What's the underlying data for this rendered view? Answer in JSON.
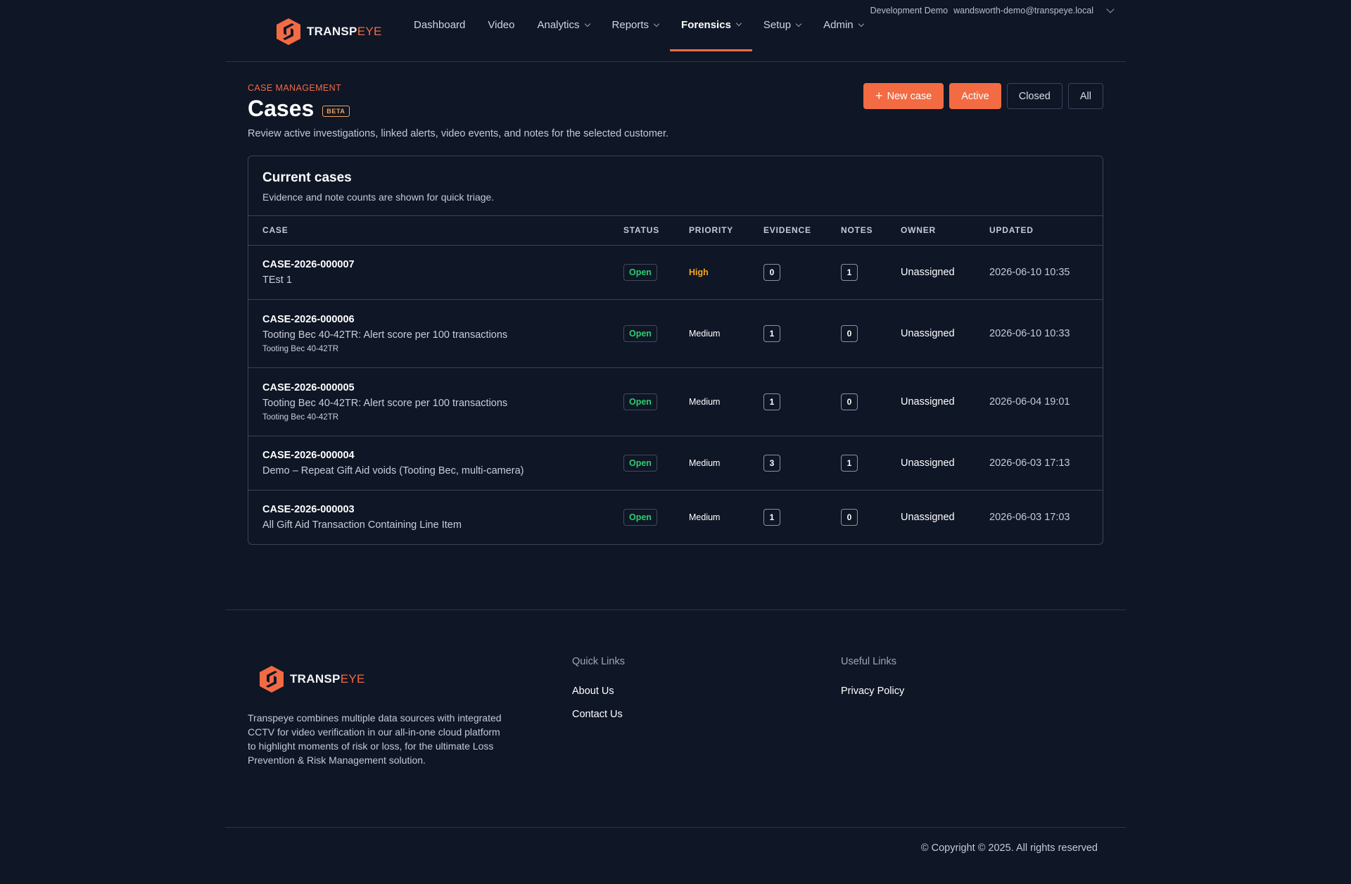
{
  "account": {
    "org": "Development Demo",
    "email": "wandsworth-demo@transpeye.local"
  },
  "brand": {
    "name_a": "TRANSP",
    "name_b": "EYE",
    "accent": "#f26b43"
  },
  "nav": [
    {
      "label": "Dashboard",
      "dropdown": false,
      "active": false
    },
    {
      "label": "Video",
      "dropdown": false,
      "active": false
    },
    {
      "label": "Analytics",
      "dropdown": true,
      "active": false
    },
    {
      "label": "Reports",
      "dropdown": true,
      "active": false
    },
    {
      "label": "Forensics",
      "dropdown": true,
      "active": true
    },
    {
      "label": "Setup",
      "dropdown": true,
      "active": false
    },
    {
      "label": "Admin",
      "dropdown": true,
      "active": false
    }
  ],
  "page": {
    "kicker": "CASE MANAGEMENT",
    "title": "Cases",
    "badge": "BETA",
    "description": "Review active investigations, linked alerts, video events, and notes for the selected customer."
  },
  "actions": {
    "new_case": "New case",
    "active": "Active",
    "closed": "Closed",
    "all": "All"
  },
  "table": {
    "title": "Current cases",
    "subtitle": "Evidence and note counts are shown for quick triage.",
    "columns": [
      "CASE",
      "STATUS",
      "PRIORITY",
      "EVIDENCE",
      "NOTES",
      "OWNER",
      "UPDATED"
    ],
    "rows": [
      {
        "id": "CASE-2026-000007",
        "title": "TEst 1",
        "store": "",
        "status": "Open",
        "priority": "High",
        "evidence": "0",
        "notes": "1",
        "owner": "Unassigned",
        "updated": "2026-06-10 10:35"
      },
      {
        "id": "CASE-2026-000006",
        "title": "Tooting Bec 40-42TR: Alert score per 100 transactions",
        "store": "Tooting Bec 40-42TR",
        "status": "Open",
        "priority": "Medium",
        "evidence": "1",
        "notes": "0",
        "owner": "Unassigned",
        "updated": "2026-06-10 10:33"
      },
      {
        "id": "CASE-2026-000005",
        "title": "Tooting Bec 40-42TR: Alert score per 100 transactions",
        "store": "Tooting Bec 40-42TR",
        "status": "Open",
        "priority": "Medium",
        "evidence": "1",
        "notes": "0",
        "owner": "Unassigned",
        "updated": "2026-06-04 19:01"
      },
      {
        "id": "CASE-2026-000004",
        "title": "Demo – Repeat Gift Aid voids (Tooting Bec, multi-camera)",
        "store": "",
        "status": "Open",
        "priority": "Medium",
        "evidence": "3",
        "notes": "1",
        "owner": "Unassigned",
        "updated": "2026-06-03 17:13"
      },
      {
        "id": "CASE-2026-000003",
        "title": "All Gift Aid Transaction Containing Line Item",
        "store": "",
        "status": "Open",
        "priority": "Medium",
        "evidence": "1",
        "notes": "0",
        "owner": "Unassigned",
        "updated": "2026-06-03 17:03"
      }
    ]
  },
  "footer": {
    "description": "Transpeye combines multiple data sources with integrated CCTV for video verification in our all-in-one cloud platform to highlight moments of risk or loss, for the ultimate Loss Prevention & Risk Management solution.",
    "quick_links_title": "Quick Links",
    "quick_links": [
      "About Us",
      "Contact Us"
    ],
    "useful_links_title": "Useful Links",
    "useful_links": [
      "Privacy Policy"
    ],
    "copyright": "© Copyright © 2025. All rights reserved"
  }
}
